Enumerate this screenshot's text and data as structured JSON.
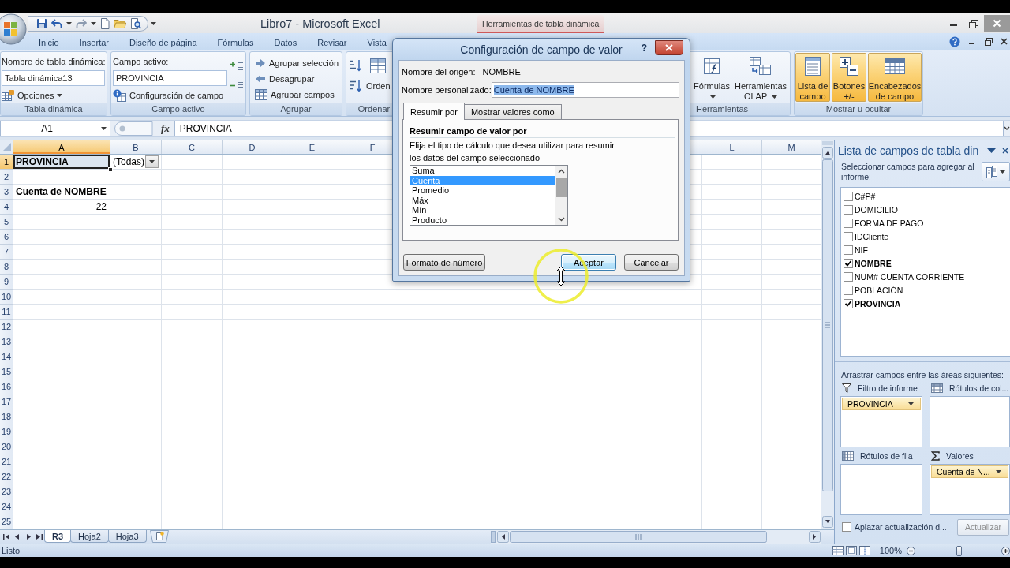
{
  "window": {
    "title": "Libro7 - Microsoft Excel",
    "context_header": "Herramientas de tabla dinámica"
  },
  "ribbon_tabs": [
    {
      "label": "Inicio",
      "selected": false
    },
    {
      "label": "Insertar",
      "selected": false
    },
    {
      "label": "Diseño de página",
      "selected": false
    },
    {
      "label": "Fórmulas",
      "selected": false
    },
    {
      "label": "Datos",
      "selected": false
    },
    {
      "label": "Revisar",
      "selected": false
    },
    {
      "label": "Vista",
      "selected": false
    }
  ],
  "ribbon": {
    "pivot_table": {
      "name_label": "Nombre de tabla dinámica:",
      "name_value": "Tabla dinámica13",
      "options_button": "Opciones",
      "group_label": "Tabla dinámica"
    },
    "active_field": {
      "field_label": "Campo activo:",
      "field_value": "PROVINCIA",
      "settings_button": "Configuración de campo",
      "group_label": "Campo activo"
    },
    "grouping": {
      "buttons": [
        "Agrupar selección",
        "Desagrupar",
        "Agrupar campos"
      ],
      "group_label": "Agrupar"
    },
    "sorting": {
      "button": "Orden",
      "group_label": "Ordenar"
    },
    "tools": {
      "buttons": [
        "Fórmulas",
        "Herramientas OLAP"
      ],
      "group_label": "Herramientas"
    },
    "show_hide": {
      "buttons": [
        {
          "label": "Lista de campo",
          "on": true
        },
        {
          "label": "Botones +/-",
          "on": true
        },
        {
          "label": "Encabezados de campo",
          "on": true
        }
      ],
      "group_label": "Mostrar u ocultar"
    }
  },
  "formula_bar": {
    "name_box": "A1",
    "function_button": "fx",
    "formula": "PROVINCIA"
  },
  "sheet": {
    "columns_left": [
      {
        "label": "A",
        "selected": true
      },
      {
        "label": "B",
        "selected": false
      },
      {
        "label": "C",
        "selected": false
      },
      {
        "label": "D",
        "selected": false
      },
      {
        "label": "E",
        "selected": false
      },
      {
        "label": "F",
        "selected": false
      }
    ],
    "columns_right": [
      {
        "label": "L",
        "selected": false
      },
      {
        "label": "M",
        "selected": false
      }
    ],
    "rows": [
      {
        "number": "1",
        "selected": true,
        "cells": [
          {
            "text": "PROVINCIA",
            "kind": "filter_label",
            "selected": true
          },
          {
            "text": "(Todas)",
            "kind": "filter_value",
            "selected": false
          }
        ]
      },
      {
        "number": "2",
        "selected": false
      },
      {
        "number": "3",
        "selected": false,
        "cells": [
          {
            "text": "Cuenta de NOMBRE",
            "kind": "header",
            "selected": false
          }
        ]
      },
      {
        "number": "4",
        "selected": false,
        "cells": [
          {
            "text": "22",
            "kind": "number",
            "selected": false
          }
        ]
      },
      {
        "number": "5",
        "selected": false
      },
      {
        "number": "6",
        "selected": false
      },
      {
        "number": "7",
        "selected": false
      },
      {
        "number": "8",
        "selected": false
      },
      {
        "number": "9",
        "selected": false
      },
      {
        "number": "10",
        "selected": false
      },
      {
        "number": "11",
        "selected": false
      },
      {
        "number": "12",
        "selected": false
      },
      {
        "number": "13",
        "selected": false
      },
      {
        "number": "14",
        "selected": false
      },
      {
        "number": "15",
        "selected": false
      },
      {
        "number": "16",
        "selected": false
      },
      {
        "number": "17",
        "selected": false
      },
      {
        "number": "18",
        "selected": false
      },
      {
        "number": "19",
        "selected": false
      },
      {
        "number": "20",
        "selected": false
      },
      {
        "number": "21",
        "selected": false
      },
      {
        "number": "22",
        "selected": false
      },
      {
        "number": "23",
        "selected": false
      },
      {
        "number": "24",
        "selected": false
      },
      {
        "number": "25",
        "selected": false
      }
    ]
  },
  "sheet_tabs": [
    {
      "label": "R3",
      "selected": true
    },
    {
      "label": "Hoja2",
      "selected": false
    },
    {
      "label": "Hoja3",
      "selected": false
    }
  ],
  "field_list": {
    "title": "Lista de campos de tabla din",
    "instruction": "Seleccionar campos para agregar al informe:",
    "fields": [
      {
        "name": "C#P#",
        "checked": false
      },
      {
        "name": "DOMICILIO",
        "checked": false
      },
      {
        "name": "FORMA DE PAGO",
        "checked": false
      },
      {
        "name": "IDCliente",
        "checked": false
      },
      {
        "name": "NIF",
        "checked": false
      },
      {
        "name": "NOMBRE",
        "checked": true
      },
      {
        "name": "NUM# CUENTA CORRIENTE",
        "checked": false
      },
      {
        "name": "POBLACIÓN",
        "checked": false
      },
      {
        "name": "PROVINCIA",
        "checked": true
      }
    ],
    "areas_instruction": "Arrastrar campos entre las áreas siguientes:",
    "areas": [
      {
        "kind": "filter",
        "label": "Filtro de informe",
        "items": [
          "PROVINCIA"
        ]
      },
      {
        "kind": "columns",
        "label": "Rótulos de col..."
      },
      {
        "kind": "rows",
        "label": "Rótulos de fila"
      },
      {
        "kind": "values",
        "label": "Valores",
        "items": [
          "Cuenta de N..."
        ]
      }
    ],
    "defer_update": {
      "label": "Aplazar actualización d...",
      "checked": false
    },
    "update_button": {
      "label": "Actualizar",
      "disabled": true
    }
  },
  "dialog": {
    "title": "Configuración de campo de valor",
    "help_button": "?",
    "source_label": "Nombre del origen:",
    "source_value": "NOMBRE",
    "custom_name": {
      "label": "Nombre personalizado:",
      "value": "Cuenta de NOMBRE",
      "value_selected": true
    },
    "tabs": [
      {
        "label": "Resumir por",
        "selected": true
      },
      {
        "label": "Mostrar valores como",
        "selected": false
      }
    ],
    "section_title": "Resumir campo de valor por",
    "description": "Elija el tipo de cálculo que desea utilizar para resumir los datos del campo seleccionado",
    "functions": [
      {
        "label": "Suma",
        "selected": false
      },
      {
        "label": "Cuenta",
        "selected": true
      },
      {
        "label": "Promedio",
        "selected": false
      },
      {
        "label": "Máx",
        "selected": false
      },
      {
        "label": "Mín",
        "selected": false
      },
      {
        "label": "Producto",
        "selected": false
      }
    ],
    "buttons": [
      {
        "label": "Formato de número",
        "default": false
      },
      {
        "label": "Aceptar",
        "default": true
      },
      {
        "label": "Cancelar",
        "default": false
      }
    ]
  },
  "status_bar": {
    "status": "Listo",
    "zoom": "100%",
    "zoom_slider": {
      "level": 0.5
    }
  }
}
